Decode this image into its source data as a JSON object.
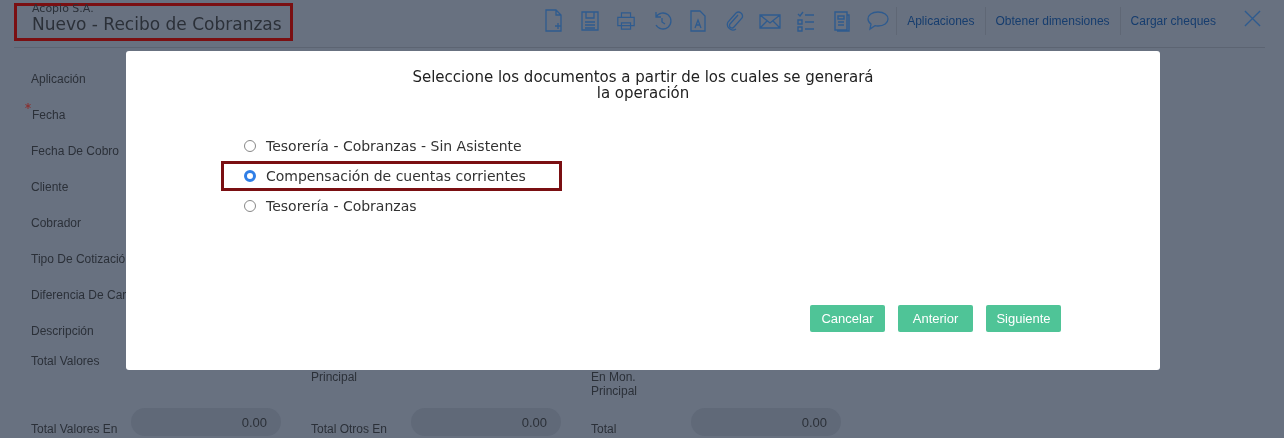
{
  "header": {
    "company": "Acopio S.A.",
    "title": "Nuevo - Recibo de Cobranzas",
    "title_highlighted": true
  },
  "toolbar": {
    "links": [
      "Aplicaciones",
      "Obtener dimensiones",
      "Cargar cheques"
    ]
  },
  "form": {
    "labels": [
      {
        "text": "Aplicación",
        "required": false
      },
      {
        "text": "Fecha",
        "required": true
      },
      {
        "text": "Fecha De Cobro",
        "required": false
      },
      {
        "text": "Cliente",
        "required": false
      },
      {
        "text": "Cobrador",
        "required": false
      },
      {
        "text": "Tipo De Cotizació",
        "required": false
      },
      {
        "text": "Diferencia De Car",
        "required": false
      },
      {
        "text": "Descripción",
        "required": false
      }
    ],
    "totals": [
      [
        {
          "label": "Total Valores"
        },
        {
          "label": "Principal"
        },
        {
          "label": "En Mon.\nPrincipal"
        }
      ],
      [
        {
          "label": "Total Valores En",
          "value": "0.00"
        },
        {
          "label": "Total Otros En",
          "value": "0.00"
        },
        {
          "label": "Total",
          "value": "0.00"
        }
      ]
    ]
  },
  "dialog": {
    "title": "Seleccione los documentos a partir de los cuales se generará\nla operación",
    "options": [
      {
        "label": "Tesorería - Cobranzas - Sin Asistente",
        "selected": false,
        "highlighted": false
      },
      {
        "label": "Compensación de cuentas corrientes",
        "selected": true,
        "highlighted": true
      },
      {
        "label": "Tesorería - Cobranzas",
        "selected": false,
        "highlighted": false
      }
    ],
    "buttons": [
      "Cancelar",
      "Anterior",
      "Siguiente"
    ]
  }
}
